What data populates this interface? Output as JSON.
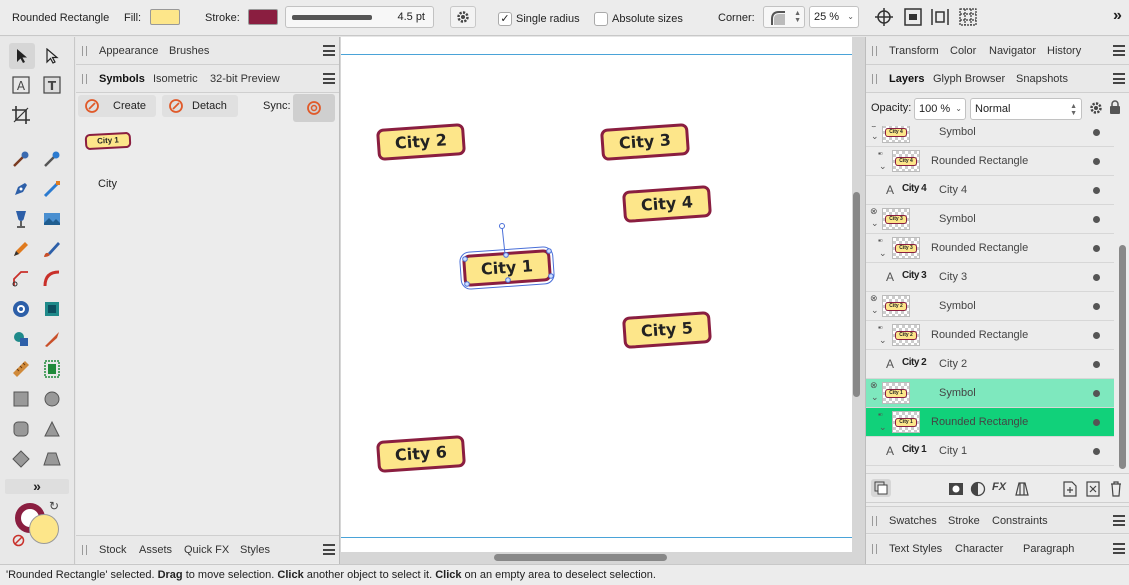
{
  "context_toolbar": {
    "object_name": "Rounded Rectangle",
    "fill_label": "Fill:",
    "fill_color": "#fde68a",
    "stroke_label": "Stroke:",
    "stroke_color": "#8a1e40",
    "stroke_width": "4.5 pt",
    "single_radius_label": "Single radius",
    "single_radius_checked": true,
    "absolute_sizes_label": "Absolute sizes",
    "absolute_sizes_checked": false,
    "corner_label": "Corner:",
    "corner_value": "25 %"
  },
  "symbols_panel": {
    "top_tabs": [
      "Appearance",
      "Brushes"
    ],
    "tabs": [
      "Symbols",
      "Isometric",
      "32-bit Preview"
    ],
    "active_tab": "Symbols",
    "create_label": "Create",
    "detach_label": "Detach",
    "sync_label": "Sync:",
    "symbol_thumb_text": "City 1",
    "symbol_name": "City",
    "bottom_tabs": [
      "Stock",
      "Assets",
      "Quick FX",
      "Styles"
    ]
  },
  "canvas": {
    "cities": [
      "City 1",
      "City 2",
      "City 3",
      "City 4",
      "City 5",
      "City 6"
    ],
    "fill_color": "#fde68a",
    "stroke_color": "#8a1e40",
    "selected": "City 1"
  },
  "right_panel": {
    "top_tabs": [
      "Transform",
      "Color",
      "Navigator",
      "History"
    ],
    "layer_tabs": [
      "Layers",
      "Glyph Browser",
      "Snapshots"
    ],
    "active_layer_tab": "Layers",
    "opacity_label": "Opacity:",
    "opacity_value": "100 %",
    "blend_mode": "Normal",
    "layers": [
      {
        "type": "symbol",
        "name": "Symbol",
        "thumb": "City 4"
      },
      {
        "type": "shape",
        "name": "Rounded Rectangle",
        "thumb": "City 4"
      },
      {
        "type": "text",
        "name": "City 4",
        "thumb": "City 4"
      },
      {
        "type": "symbol",
        "name": "Symbol",
        "thumb": "City 3"
      },
      {
        "type": "shape",
        "name": "Rounded Rectangle",
        "thumb": "City 3"
      },
      {
        "type": "text",
        "name": "City 3",
        "thumb": "City 3"
      },
      {
        "type": "symbol",
        "name": "Symbol",
        "thumb": "City 2"
      },
      {
        "type": "shape",
        "name": "Rounded Rectangle",
        "thumb": "City 2"
      },
      {
        "type": "text",
        "name": "City 2",
        "thumb": "City 2"
      },
      {
        "type": "symbol",
        "name": "Symbol",
        "thumb": "City 1",
        "highlight": "light"
      },
      {
        "type": "shape",
        "name": "Rounded Rectangle",
        "thumb": "City 1",
        "highlight": "selected"
      },
      {
        "type": "text",
        "name": "City 1",
        "thumb": "City 1"
      }
    ],
    "swatches_tabs": [
      "Swatches",
      "Stroke",
      "Constraints"
    ],
    "text_tabs": [
      "Text Styles",
      "Character",
      "Paragraph"
    ]
  },
  "status_bar": {
    "segments": [
      {
        "t": "'Rounded Rectangle' selected. ",
        "b": false
      },
      {
        "t": "Drag",
        "b": true
      },
      {
        "t": " to move selection. ",
        "b": false
      },
      {
        "t": "Click",
        "b": true
      },
      {
        "t": " another object to select it. ",
        "b": false
      },
      {
        "t": "Click",
        "b": true
      },
      {
        "t": " on an empty area to deselect selection.",
        "b": false
      }
    ]
  }
}
